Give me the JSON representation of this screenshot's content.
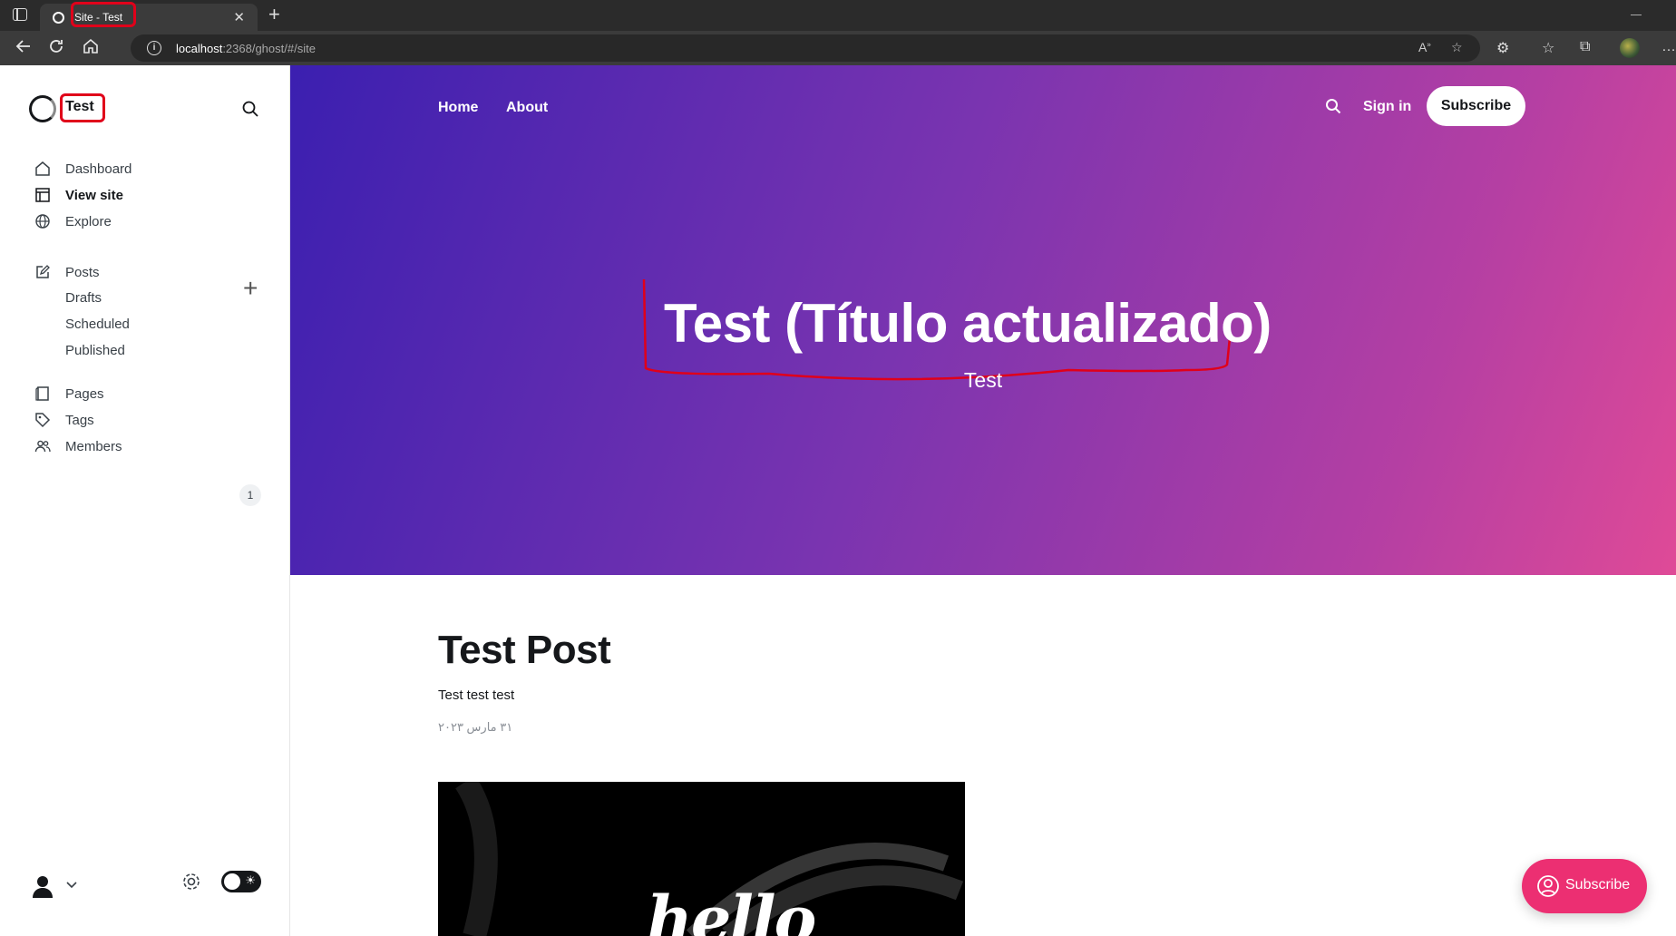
{
  "browser": {
    "tab_title": "Site - Test",
    "url_host": "localhost",
    "url_path": ":2368/ghost/#/site"
  },
  "sidebar": {
    "brand": "Test",
    "nav": [
      {
        "label": "Dashboard",
        "icon": "home-icon"
      },
      {
        "label": "View site",
        "icon": "layout-icon"
      },
      {
        "label": "Explore",
        "icon": "globe-icon"
      }
    ],
    "posts": {
      "label": "Posts",
      "icon": "pencil-square-icon"
    },
    "post_sub": [
      "Drafts",
      "Scheduled",
      "Published"
    ],
    "more": [
      {
        "label": "Pages",
        "icon": "page-icon"
      },
      {
        "label": "Tags",
        "icon": "tag-icon"
      },
      {
        "label": "Members",
        "icon": "members-icon"
      }
    ],
    "members_count": "1"
  },
  "site": {
    "nav": [
      "Home",
      "About"
    ],
    "sign_in": "Sign in",
    "subscribe": "Subscribe",
    "hero_title": "Test (Título actualizado)",
    "hero_subtitle": "Test",
    "post": {
      "title": "Test Post",
      "excerpt": "Test test test",
      "date": "۳۱ مارس ۲۰۲۳",
      "image_text": "hello"
    },
    "portal_label": "Subscribe"
  },
  "colors": {
    "accent": "#ec2f72",
    "hero_start": "#3b1fb0",
    "hero_end": "#df4a97",
    "annotation": "#e0001a"
  }
}
